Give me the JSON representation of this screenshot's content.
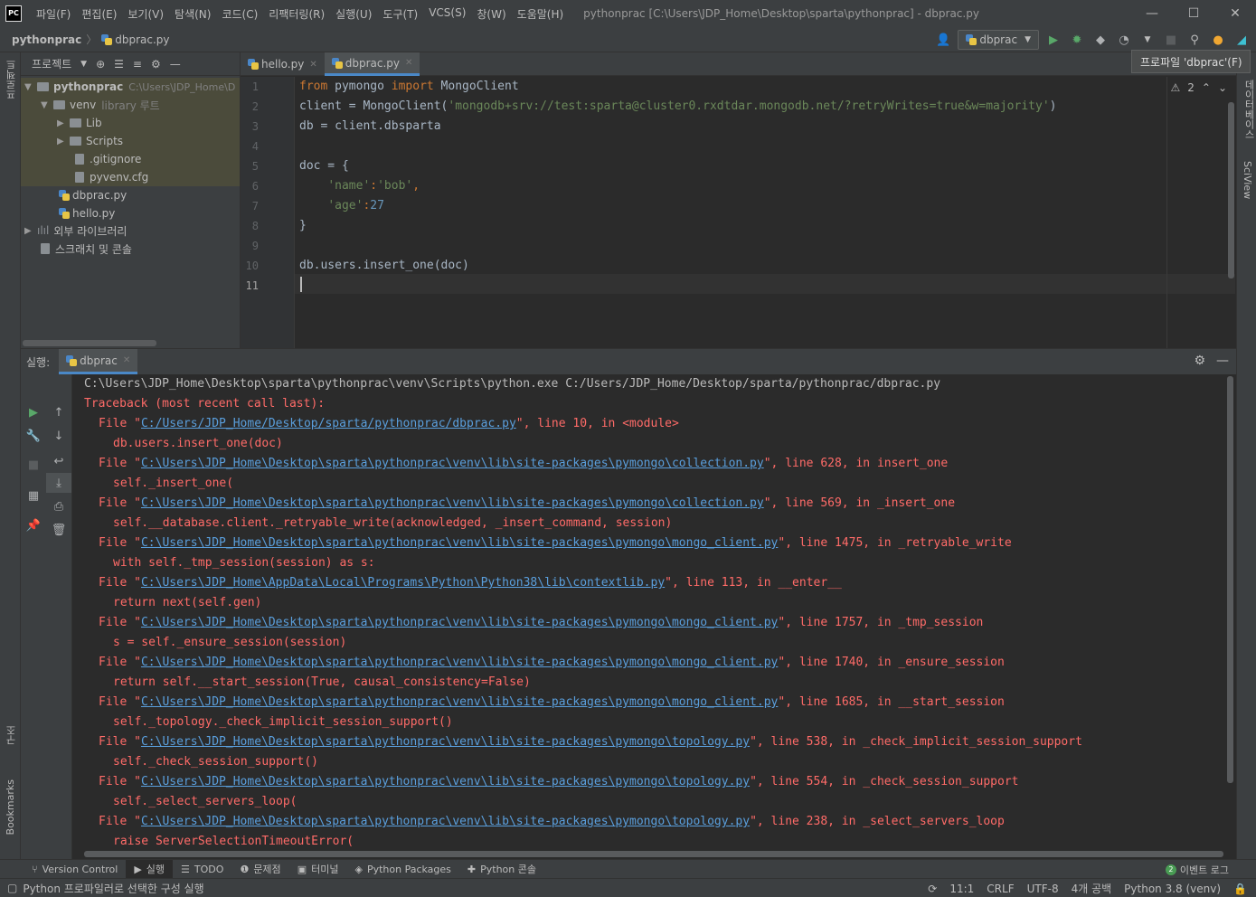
{
  "window": {
    "logo": "PC",
    "title": "pythonprac [C:\\Users\\JDP_Home\\Desktop\\sparta\\pythonprac] - dbprac.py",
    "menu": [
      "파일(F)",
      "편집(E)",
      "보기(V)",
      "탐색(N)",
      "코드(C)",
      "리팩터링(R)",
      "실행(U)",
      "도구(T)",
      "VCS(S)",
      "창(W)",
      "도움말(H)"
    ],
    "minimize": "—",
    "maximize": "☐",
    "close": "✕"
  },
  "navbar": {
    "project": "pythonprac",
    "file": "dbprac.py",
    "run_config": "dbprac",
    "tooltip": "프로파일 'dbprac'(F)"
  },
  "left_stripe": {
    "project_label": "프로젝트",
    "structure_label": "구조",
    "bookmarks_label": "Bookmarks"
  },
  "right_stripe": {
    "database_label": "데이터베이스",
    "sciview_label": "SciView"
  },
  "project_panel": {
    "title": "프로젝트",
    "tree": [
      {
        "label": "pythonprac",
        "hint": "C:\\Users\\JDP_Home\\D"
      },
      {
        "label": "venv",
        "hint": "library 루트"
      },
      {
        "label": "Lib"
      },
      {
        "label": "Scripts"
      },
      {
        "label": ".gitignore"
      },
      {
        "label": "pyvenv.cfg"
      },
      {
        "label": "dbprac.py"
      },
      {
        "label": "hello.py"
      },
      {
        "label": "외부 라이브러리"
      },
      {
        "label": "스크래치 및 콘솔"
      }
    ]
  },
  "editor": {
    "tabs": [
      {
        "label": "hello.py",
        "active": false
      },
      {
        "label": "dbprac.py",
        "active": true
      }
    ],
    "warnings": "2",
    "line_numbers": [
      "1",
      "2",
      "3",
      "4",
      "5",
      "6",
      "7",
      "8",
      "9",
      "10",
      "11"
    ],
    "code": {
      "l1_from": "from",
      "l1_mod": " pymongo ",
      "l1_import": "import",
      "l1_rest": " MongoClient",
      "l2_pre": "client = MongoClient(",
      "l2_str": "'mongodb+srv://test:sparta@cluster0.rxdtdar.mongodb.net/?retryWrites=true&w=majority'",
      "l2_post": ")",
      "l3": "db = client.dbsparta",
      "l5": "doc = {",
      "l6_key": "'name'",
      "l6_colon": ":",
      "l6_val": "'bob'",
      "l6_comma": ",",
      "l7_key": "'age'",
      "l7_colon": ":",
      "l7_val": "27",
      "l8": "}",
      "l10": "db.users.insert_one(doc)"
    }
  },
  "run_panel": {
    "label": "실행:",
    "tab": "dbprac",
    "command": "C:\\Users\\JDP_Home\\Desktop\\sparta\\pythonprac\\venv\\Scripts\\python.exe C:/Users/JDP_Home/Desktop/sparta/pythonprac/dbprac.py",
    "traceback_header": "Traceback (most recent call last):",
    "frames": [
      {
        "path": "C:/Users/JDP_Home/Desktop/sparta/pythonprac/dbprac.py",
        "loc": "\", line 10, in <module>",
        "code": "db.users.insert_one(doc)"
      },
      {
        "path": "C:\\Users\\JDP_Home\\Desktop\\sparta\\pythonprac\\venv\\lib\\site-packages\\pymongo\\collection.py",
        "loc": "\", line 628, in insert_one",
        "code": "self._insert_one("
      },
      {
        "path": "C:\\Users\\JDP_Home\\Desktop\\sparta\\pythonprac\\venv\\lib\\site-packages\\pymongo\\collection.py",
        "loc": "\", line 569, in _insert_one",
        "code": "self.__database.client._retryable_write(acknowledged, _insert_command, session)"
      },
      {
        "path": "C:\\Users\\JDP_Home\\Desktop\\sparta\\pythonprac\\venv\\lib\\site-packages\\pymongo\\mongo_client.py",
        "loc": "\", line 1475, in _retryable_write",
        "code": "with self._tmp_session(session) as s:"
      },
      {
        "path": "C:\\Users\\JDP_Home\\AppData\\Local\\Programs\\Python\\Python38\\lib\\contextlib.py",
        "loc": "\", line 113, in __enter__",
        "code": "return next(self.gen)"
      },
      {
        "path": "C:\\Users\\JDP_Home\\Desktop\\sparta\\pythonprac\\venv\\lib\\site-packages\\pymongo\\mongo_client.py",
        "loc": "\", line 1757, in _tmp_session",
        "code": "s = self._ensure_session(session)"
      },
      {
        "path": "C:\\Users\\JDP_Home\\Desktop\\sparta\\pythonprac\\venv\\lib\\site-packages\\pymongo\\mongo_client.py",
        "loc": "\", line 1740, in _ensure_session",
        "code": "return self.__start_session(True, causal_consistency=False)"
      },
      {
        "path": "C:\\Users\\JDP_Home\\Desktop\\sparta\\pythonprac\\venv\\lib\\site-packages\\pymongo\\mongo_client.py",
        "loc": "\", line 1685, in __start_session",
        "code": "self._topology._check_implicit_session_support()"
      },
      {
        "path": "C:\\Users\\JDP_Home\\Desktop\\sparta\\pythonprac\\venv\\lib\\site-packages\\pymongo\\topology.py",
        "loc": "\", line 538, in _check_implicit_session_support",
        "code": "self._check_session_support()"
      },
      {
        "path": "C:\\Users\\JDP_Home\\Desktop\\sparta\\pythonprac\\venv\\lib\\site-packages\\pymongo\\topology.py",
        "loc": "\", line 554, in _check_session_support",
        "code": "self._select_servers_loop("
      },
      {
        "path": "C:\\Users\\JDP_Home\\Desktop\\sparta\\pythonprac\\venv\\lib\\site-packages\\pymongo\\topology.py",
        "loc": "\", line 238, in _select_servers_loop",
        "code": "raise ServerSelectionTimeoutError("
      }
    ],
    "file_prefix": "File \""
  },
  "bottom_bar": {
    "items": [
      "Version Control",
      "실행",
      "TODO",
      "문제점",
      "터미널",
      "Python Packages",
      "Python 콘솔"
    ],
    "event_count": "2",
    "event_log": "이벤트 로그"
  },
  "status_bar": {
    "message": "Python 프로파일러로 선택한 구성 실행",
    "position": "11:1",
    "line_sep": "CRLF",
    "encoding": "UTF-8",
    "indent": "4개 공백",
    "interpreter": "Python 3.8 (venv)"
  },
  "colors": {
    "error": "#ff6b68",
    "link": "#5a9fdd",
    "keyword": "#cc7832",
    "string": "#6a8759",
    "number": "#6897bb",
    "accent": "#4a88c7"
  }
}
